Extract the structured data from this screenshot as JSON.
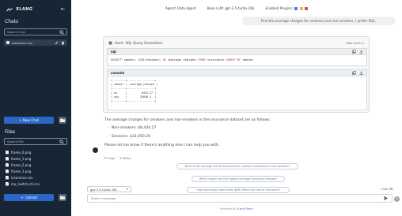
{
  "sidebar": {
    "brand": "XLANG",
    "chats_label": "Chats",
    "chat_search_placeholder": "Search Chat",
    "chats": [
      {
        "label": "insurance.csv"
      }
    ],
    "new_chat_label": "+ New Chat",
    "files_label": "Files",
    "file_search_placeholder": "Search File",
    "files": [
      {
        "name": "frame_0.png"
      },
      {
        "name": "frame_1.png"
      },
      {
        "name": "frame_2.png"
      },
      {
        "name": "frame_3.png"
      },
      {
        "name": "insurance.csv"
      },
      {
        "name": "my_switch_ctl.csv"
      }
    ],
    "upload_label": "Upload"
  },
  "topbar": {
    "agent": "Agent: Data Agent",
    "base_llm": "Base LLM: gpt-3.5-turbo-16k",
    "plugins": "Enabled Plugins:"
  },
  "user_message": "Find the average charges for smokers and non-smokers. I prefer SQL.",
  "tool": {
    "used_prefix": "Used",
    "tool_name": "SQL Query Generation",
    "hide_label": "Hide work",
    "sql_header": "sql",
    "sql_prefix": "SELECT smoker, AVG(charges) ",
    "sql_as": "AS",
    "sql_mid": " average_charges ",
    "sql_from": "FROM",
    "sql_table": " insurance ",
    "sql_group": "GROUP BY",
    "sql_suffix": " smoker",
    "console_header": "console",
    "console_output": "+--------+-----------------+\n| smoker |  average_charges |\n|--------+-----------------|\n| no     |         8434.27 |\n| yes    |        32050.2  |\n+--------+-----------------+"
  },
  "answer": {
    "intro": "The average charges for smokers and non-smokers in the insurance dataset are as follows:",
    "items": [
      "Non-smokers: $8,434.27",
      "Smokers: $32,050.20"
    ],
    "outro": "Please let me know if there's anything else I can help you with."
  },
  "message_actions": {
    "copy": "Copy",
    "retry": "Retry"
  },
  "suggestions": [
    "What is the average cost of insurance for smokers compared to non-smokers?",
    "Which region has the highest average insurance charges?",
    "How does body mass index (BMI) affect the cost of insurance?"
  ],
  "composer": {
    "model": "gpt-3.5-turbo-16k",
    "clear_label": "Clear",
    "placeholder": "Send a message",
    "footer_prefix": "Powered by ",
    "footer_link": "XLang Team"
  },
  "colors": {
    "sidebar_bg": "#182535",
    "accent": "#2b67c6"
  }
}
